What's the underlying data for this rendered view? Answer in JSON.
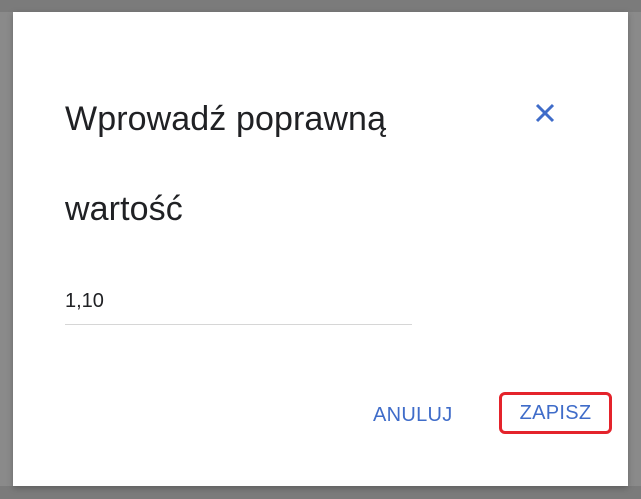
{
  "dialog": {
    "title": "Wprowadź poprawną wartość",
    "close_icon": "close-icon",
    "value": "1,10",
    "cancel_label": "ANULUJ",
    "save_label": "ZAPISZ"
  },
  "colors": {
    "accent": "#3f6cc9",
    "highlight": "#e4232b",
    "overlay": "#7a7a7a"
  }
}
